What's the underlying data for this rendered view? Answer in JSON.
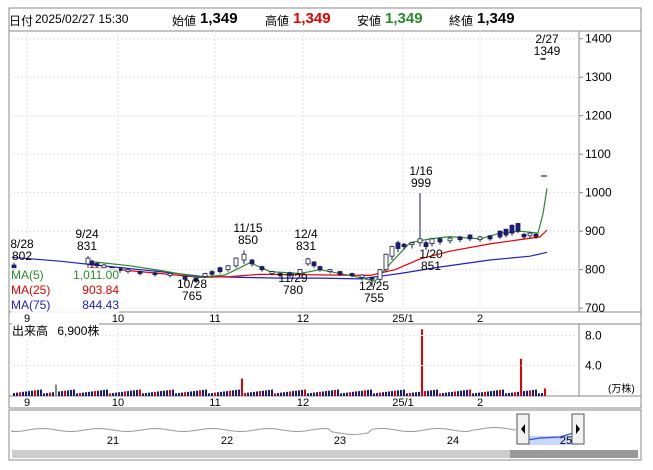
{
  "header": {
    "date_label": "日付",
    "datetime": "2025/02/27 15:30",
    "open_label": "始値",
    "open_value": "1,349",
    "high_label": "高値",
    "high_value": "1,349",
    "low_label": "安値",
    "low_value": "1,349",
    "close_label": "終値",
    "close_value": "1,349"
  },
  "moving_averages": [
    {
      "label": "MA(5)",
      "value": "1,011.00",
      "color": "#2a8a2a"
    },
    {
      "label": "MA(25)",
      "value": "903.84",
      "color": "#e30000"
    },
    {
      "label": "MA(75)",
      "value": "844.43",
      "color": "#2020c0"
    }
  ],
  "volume": {
    "label": "出来高",
    "value": "6,900株",
    "unit": "(万株)",
    "ticks": [
      "8.0",
      "4.0"
    ]
  },
  "chart_data": {
    "type": "candlestick",
    "y_ticks": [
      "1400",
      "1300",
      "1200",
      "1100",
      "1000",
      "900",
      "800",
      "700"
    ],
    "ylim": [
      690,
      1420
    ],
    "x_ticks": [
      "9",
      "10",
      "11",
      "12",
      "25/1",
      "2"
    ],
    "annotations": [
      {
        "date": "8/28",
        "value": "802"
      },
      {
        "date": "9/24",
        "value": "831"
      },
      {
        "date": "10/28",
        "value": "765"
      },
      {
        "date": "11/15",
        "value": "850"
      },
      {
        "date": "11/29",
        "value": "780"
      },
      {
        "date": "12/4",
        "value": "831"
      },
      {
        "date": "12/25",
        "value": "755"
      },
      {
        "date": "1/16",
        "value": "999"
      },
      {
        "date": "1/20",
        "value": "851"
      },
      {
        "date": "2/27",
        "value": "1349"
      }
    ],
    "highlight_volume_color": "#e30000",
    "normal_volume_color": "#1a1a7a"
  },
  "navigator": {
    "labels": [
      "21",
      "22",
      "23",
      "24",
      "25"
    ]
  },
  "colors": {
    "up_candle": "#ffffff",
    "down_candle": "#1a1a8a",
    "ma5": "#2a8a2a",
    "ma25": "#e30000",
    "ma75": "#2020c0"
  }
}
